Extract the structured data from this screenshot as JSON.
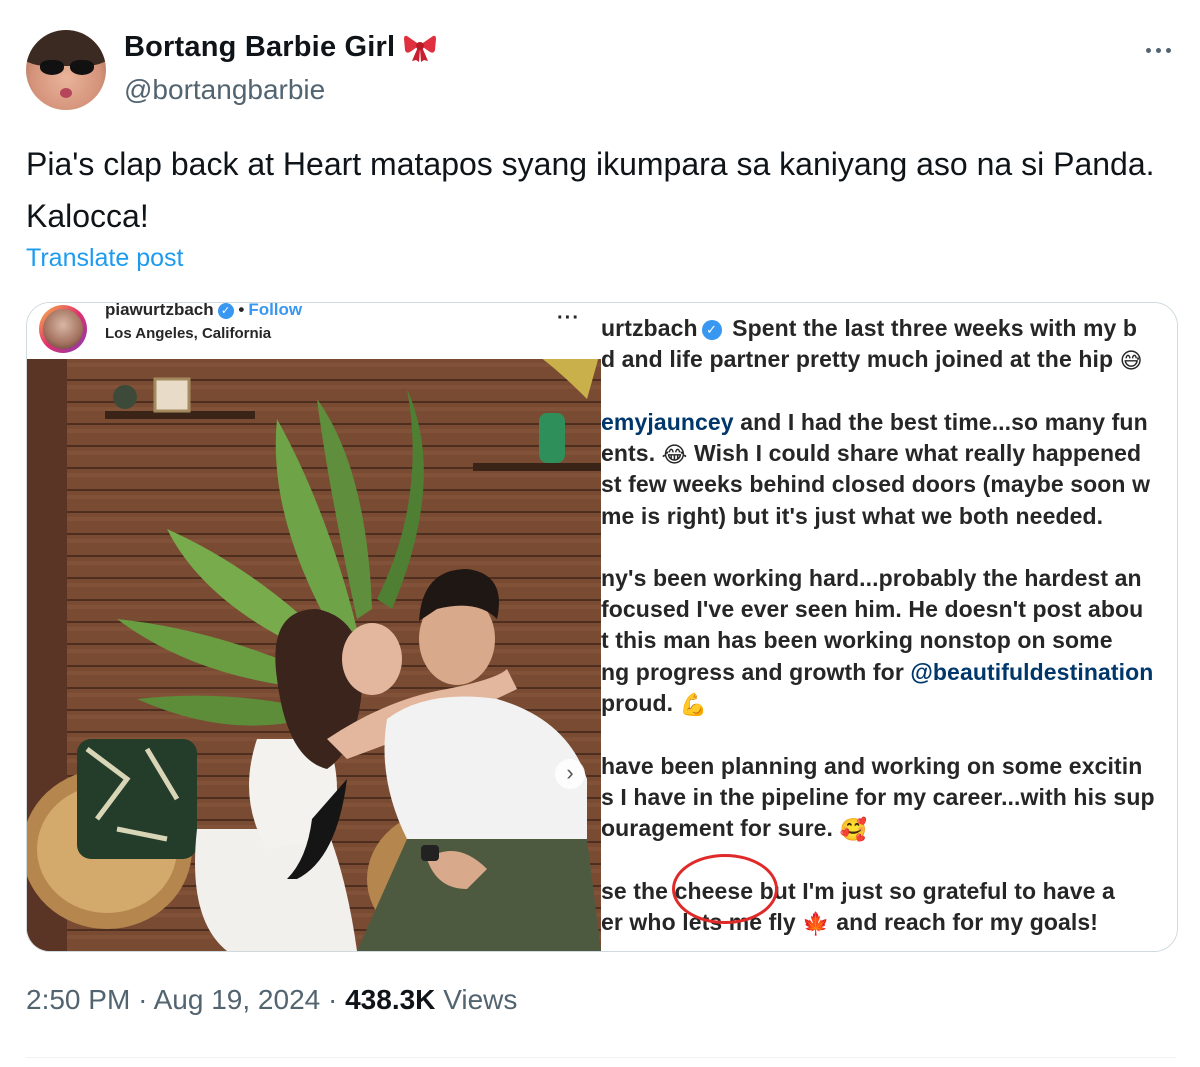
{
  "author": {
    "display_name": "Bortang Barbie Girl",
    "handle": "@bortangbarbie",
    "name_emoji_icon": "ribbon-bow-icon"
  },
  "tweet": {
    "text": "Pia's clap back at Heart matapos syang ikumpara sa kaniyang aso na si Panda. Kalocca!",
    "translate_label": "Translate post",
    "time": "2:50 PM",
    "separator": "·",
    "date": "Aug 19, 2024",
    "views_count": "438.3K",
    "views_label": "Views"
  },
  "media": {
    "ig_username": "piawurtzbach",
    "ig_follow": "Follow",
    "ig_location": "Los Angeles, California",
    "caption_lines": [
      {
        "pre": "urtzbach",
        "verified": true,
        "text": " Spent the last three weeks with my b"
      },
      {
        "text": "d and life partner pretty much joined at the hip ",
        "emoji": "😅"
      },
      {
        "mention": "emyjauncey",
        "text": " and I had the best time...so many fun"
      },
      {
        "pre_text": "ents. ",
        "emoji": "😂",
        "text": " Wish I could share what really happened"
      },
      {
        "text": "st few weeks behind closed doors (maybe soon w"
      },
      {
        "text": "me is right) but it's just what we both needed."
      },
      {
        "text": "ny's been working hard...probably the hardest an"
      },
      {
        "text": " focused I've ever seen him. He doesn't post abou"
      },
      {
        "text": "t this man has been working nonstop on some"
      },
      {
        "text": "ng progress and growth for ",
        "mention": "@beautifuldestination"
      },
      {
        "text": " proud. ",
        "emoji": "💪"
      },
      {
        "text": " have been planning and working on some excitin"
      },
      {
        "text": "s I have in the pipeline for my career...with his sup"
      },
      {
        "text": "ouragement for sure. ",
        "emoji": "🥰"
      },
      {
        "text": "se the cheese but I'm just so grateful to have a"
      },
      {
        "text": "er who lets me fly ",
        "emoji": "🍁",
        "text_after": " and reach for my goals!"
      }
    ]
  }
}
